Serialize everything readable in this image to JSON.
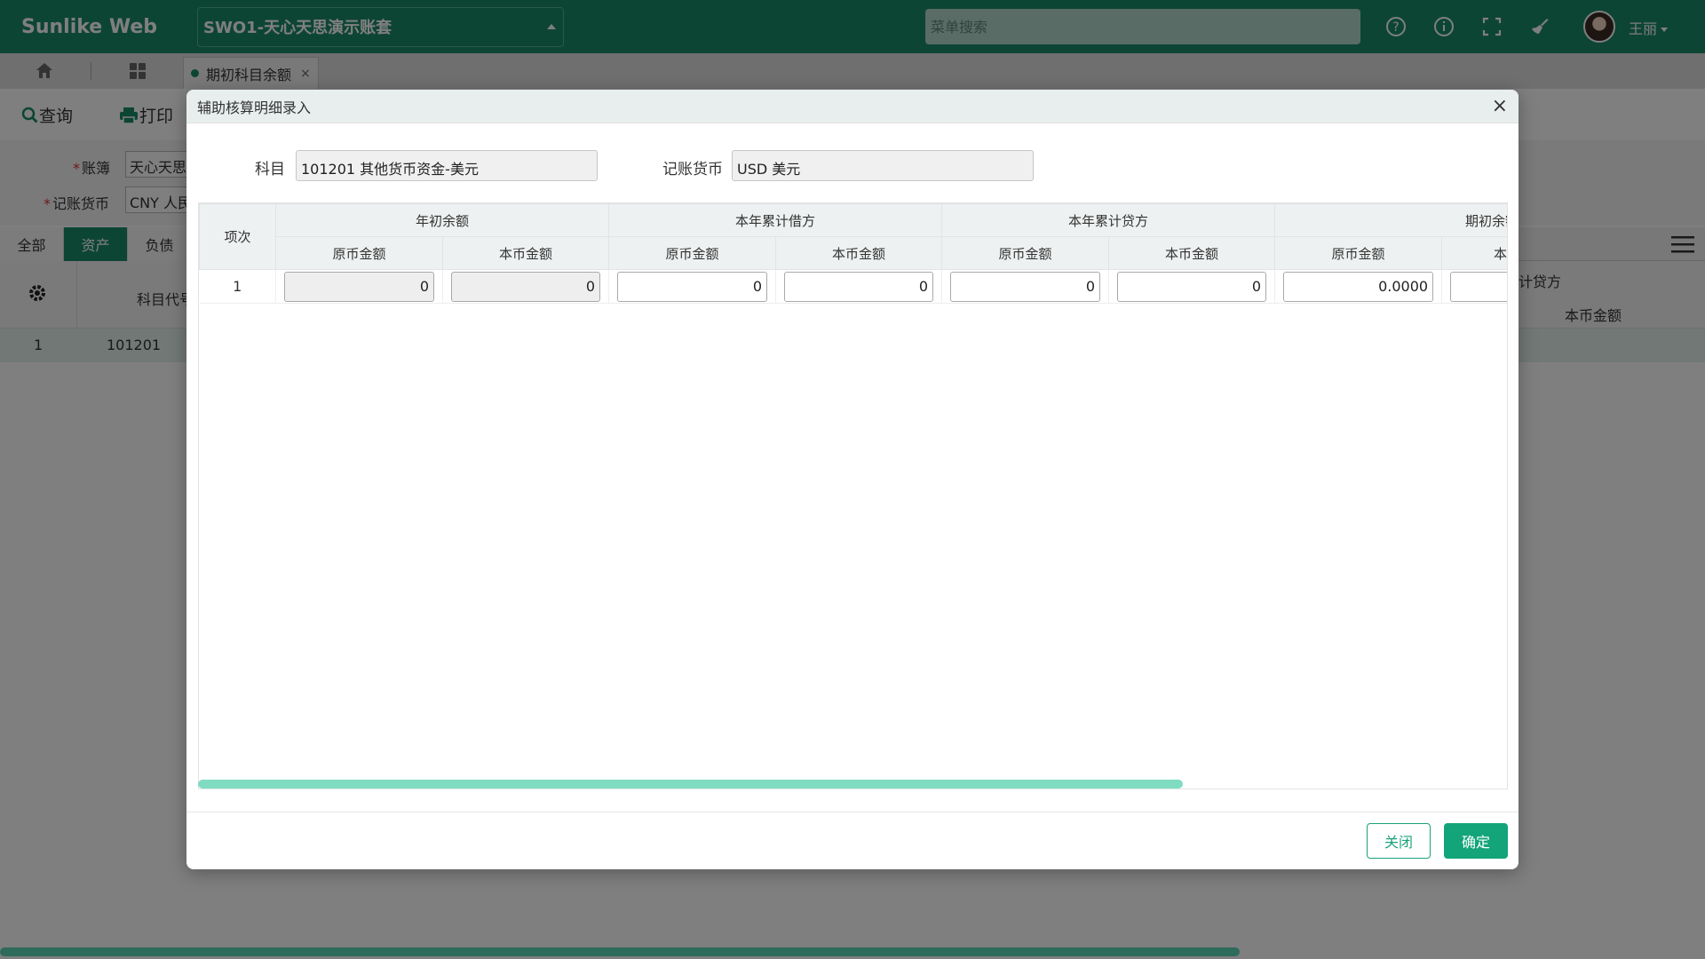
{
  "topbar": {
    "brand": "Sunlike Web",
    "account_select": "SWO1-天心天思演示账套",
    "menu_search_placeholder": "菜单搜索",
    "username": "王丽"
  },
  "page_tabs": {
    "active_tab": "期初科目余额",
    "close": "×"
  },
  "toolbar": {
    "query_label": "查询",
    "print_label": "打印"
  },
  "filters": {
    "book_label": "账簿",
    "book_value": "天心天思",
    "currency_label": "记账货币",
    "currency_value": "CNY 人民"
  },
  "category_tabs": [
    "全部",
    "资产",
    "负债"
  ],
  "grid": {
    "col_code": "科目代号",
    "col_credit_partial": "计贷方",
    "col_local_amount": "本币金额",
    "rows": [
      {
        "index": "1",
        "code": "101201"
      }
    ]
  },
  "modal": {
    "title": "辅助核算明细录入",
    "close_symbol": "×",
    "account_label": "科目",
    "account_value": "101201 其他货币资金-美元",
    "currency_label": "记账货币",
    "currency_value": "USD 美元",
    "table": {
      "col_item": "项次",
      "groups": [
        "年初余额",
        "本年累计借方",
        "本年累计贷方",
        "期初余额"
      ],
      "sub_original": "原币金额",
      "sub_local": "本币金额",
      "sub_local_partial": "本",
      "rows": [
        {
          "item": "1",
          "values": [
            "0",
            "0",
            "0",
            "0",
            "0",
            "0",
            "0.0000",
            ""
          ]
        }
      ]
    },
    "close_button": "关闭",
    "ok_button": "确定"
  },
  "colors": {
    "brand_green": "#1a8a68",
    "button_green": "#13a47a",
    "scroll_teal": "#7fdcc1"
  }
}
